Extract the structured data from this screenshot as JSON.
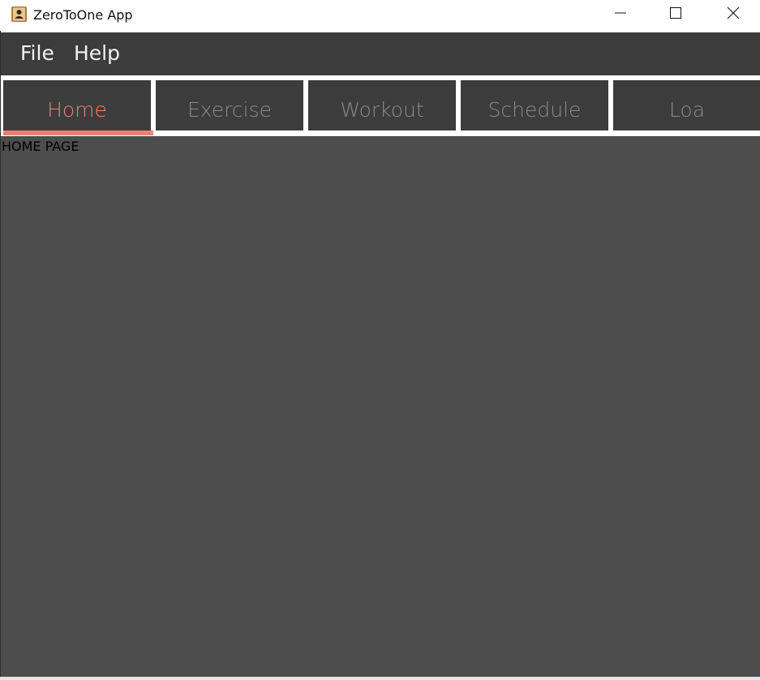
{
  "window": {
    "title": "ZeroToOne App",
    "icon": "contact-book-icon",
    "controls": {
      "minimize": "minimize-icon",
      "maximize": "maximize-icon",
      "close": "close-icon"
    }
  },
  "menubar": {
    "items": [
      {
        "label": "File"
      },
      {
        "label": "Help"
      }
    ]
  },
  "tabs": {
    "items": [
      {
        "label": "Home",
        "active": true
      },
      {
        "label": "Exercise",
        "active": false
      },
      {
        "label": "Workout",
        "active": false
      },
      {
        "label": "Schedule",
        "active": false
      },
      {
        "label": "Loa",
        "active": false
      }
    ]
  },
  "content": {
    "page_label": "HOME PAGE"
  },
  "colors": {
    "accent": "#ef7f74",
    "menubar_bg": "#3c3c3c",
    "content_bg": "#4d4d4d",
    "inactive_tab_text": "#8a8a8a"
  }
}
